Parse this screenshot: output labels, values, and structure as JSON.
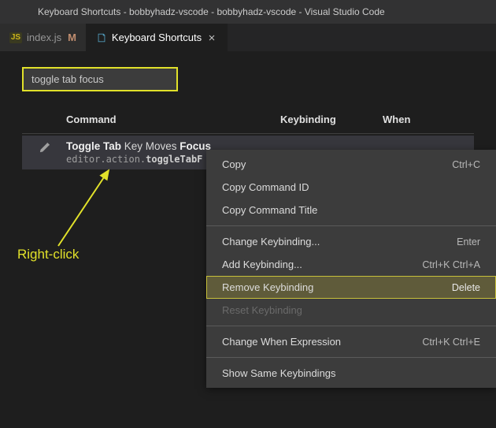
{
  "title": "Keyboard Shortcuts - bobbyhadz-vscode - bobbyhadz-vscode - Visual Studio Code",
  "tabs": [
    {
      "label": "index.js",
      "modified": "M"
    },
    {
      "label": "Keyboard Shortcuts"
    }
  ],
  "search_value": "toggle tab focus",
  "columns": {
    "command": "Command",
    "keybinding": "Keybinding",
    "when": "When"
  },
  "row": {
    "title_pre": "Toggle Tab",
    "title_mid": " Key Moves ",
    "title_post": "Focus",
    "sub_pre": "editor.action.",
    "sub_post": "toggleTabF"
  },
  "context": {
    "copy": "Copy",
    "copy_sc": "Ctrl+C",
    "copy_id": "Copy Command ID",
    "copy_title": "Copy Command Title",
    "change": "Change Keybinding...",
    "change_sc": "Enter",
    "add": "Add Keybinding...",
    "add_sc": "Ctrl+K Ctrl+A",
    "remove": "Remove Keybinding",
    "remove_sc": "Delete",
    "reset": "Reset Keybinding",
    "when": "Change When Expression",
    "when_sc": "Ctrl+K Ctrl+E",
    "same": "Show Same Keybindings"
  },
  "annotation": "Right-click"
}
